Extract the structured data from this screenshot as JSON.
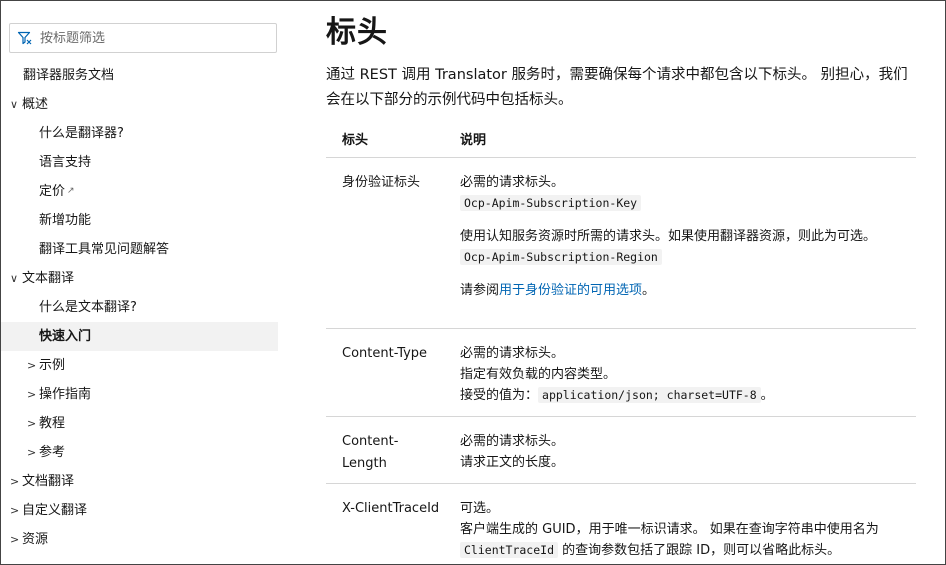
{
  "sidebar": {
    "filter_placeholder": "按标题筛选",
    "items": [
      {
        "label": "翻译器服务文档",
        "level": 0,
        "chevron": ""
      },
      {
        "label": "概述",
        "level": 0,
        "chevron": "∨"
      },
      {
        "label": "什么是翻译器?",
        "level": 1,
        "chevron": ""
      },
      {
        "label": "语言支持",
        "level": 1,
        "chevron": ""
      },
      {
        "label": "定价",
        "level": 1,
        "chevron": "",
        "external": true
      },
      {
        "label": "新增功能",
        "level": 1,
        "chevron": ""
      },
      {
        "label": "翻译工具常见问题解答",
        "level": 1,
        "chevron": ""
      },
      {
        "label": "文本翻译",
        "level": 0,
        "chevron": "∨"
      },
      {
        "label": "什么是文本翻译?",
        "level": 1,
        "chevron": ""
      },
      {
        "label": "快速入门",
        "level": 1,
        "chevron": "",
        "active": true
      },
      {
        "label": "示例",
        "level": 1,
        "chevron": ">"
      },
      {
        "label": "操作指南",
        "level": 1,
        "chevron": ">"
      },
      {
        "label": "教程",
        "level": 1,
        "chevron": ">"
      },
      {
        "label": "参考",
        "level": 1,
        "chevron": ">"
      },
      {
        "label": "文档翻译",
        "level": 0,
        "chevron": ">"
      },
      {
        "label": "自定义翻译",
        "level": 0,
        "chevron": ">"
      },
      {
        "label": "资源",
        "level": 0,
        "chevron": ">"
      }
    ]
  },
  "main": {
    "title": "标头",
    "intro": "通过 REST 调用 Translator 服务时，需要确保每个请求中都包含以下标头。 别担心，我们会在以下部分的示例代码中包括标头。",
    "table": {
      "headers": [
        "标头",
        "说明"
      ],
      "rows": [
        {
          "name": "身份验证标头",
          "lines": [
            {
              "text": "必需的请求标头。"
            },
            {
              "code": "Ocp-Apim-Subscription-Key"
            },
            {
              "gap": true
            },
            {
              "text": "使用认知服务资源时所需的请求头。如果使用翻译器资源，则此为可选。"
            },
            {
              "code": "Ocp-Apim-Subscription-Region"
            },
            {
              "gap": true
            },
            {
              "text": "请参阅",
              "link": "用于身份验证的可用选项",
              "after": "。"
            }
          ]
        },
        {
          "name": "Content-Type",
          "lines": [
            {
              "text": "必需的请求标头。"
            },
            {
              "text": "指定有效负载的内容类型。"
            },
            {
              "text": "接受的值为：",
              "code": "application/json; charset=UTF-8",
              "after": "。"
            }
          ]
        },
        {
          "name": "Content-Length",
          "lines": [
            {
              "text": "必需的请求标头。"
            },
            {
              "text": "请求正文的长度。"
            }
          ]
        },
        {
          "name": "X-ClientTraceId",
          "lines": [
            {
              "text": "可选。"
            },
            {
              "text": "客户端生成的 GUID，用于唯一标识请求。 如果在查询字符串中使用名为"
            },
            {
              "code": "ClientTraceId",
              "after": " 的查询参数包括了跟踪 ID，则可以省略此标头。"
            }
          ]
        }
      ]
    }
  }
}
